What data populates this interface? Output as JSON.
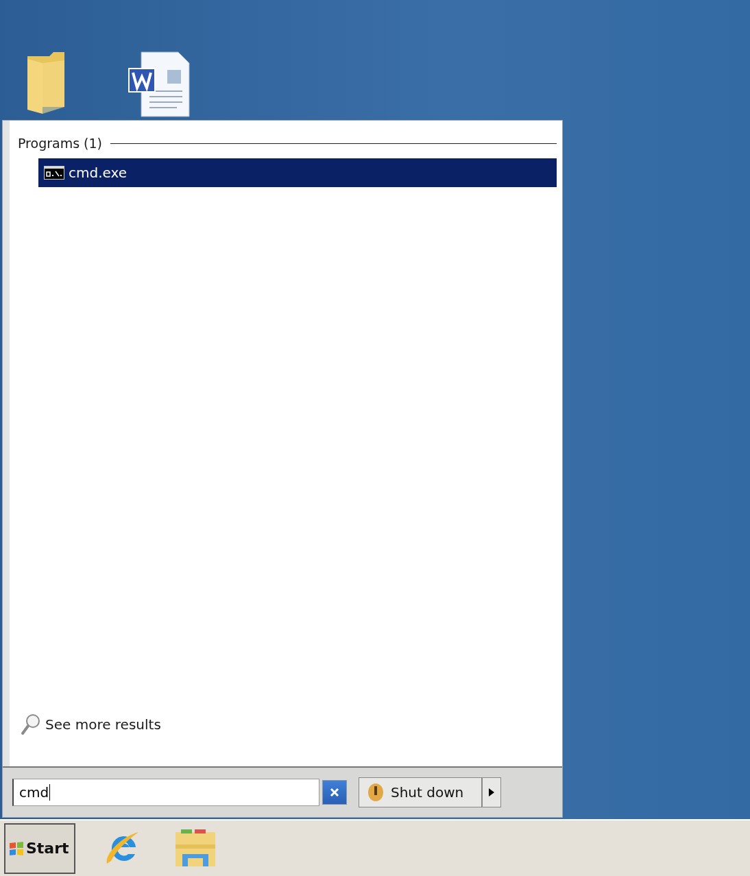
{
  "start_menu": {
    "group": {
      "title": "Programs (1)",
      "items": [
        {
          "label": "cmd.exe",
          "selected": true
        }
      ]
    },
    "more_results": "See more results",
    "search": {
      "value": "cmd"
    },
    "shutdown": {
      "label": "Shut down"
    }
  },
  "taskbar": {
    "start": "Start"
  }
}
